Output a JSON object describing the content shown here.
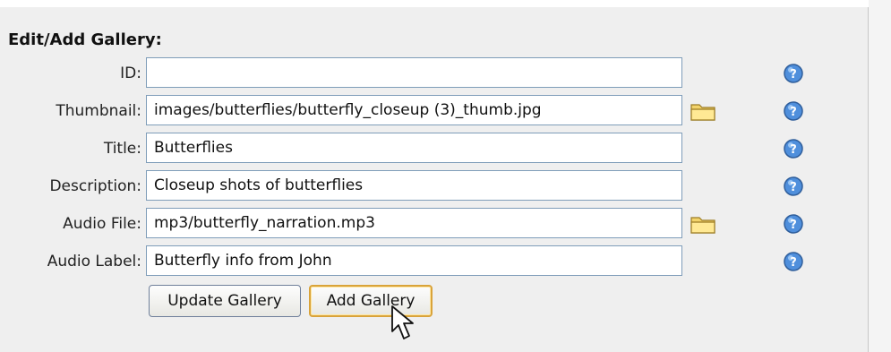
{
  "form": {
    "heading": "Edit/Add Gallery:",
    "fields": [
      {
        "label": "ID:",
        "value": "",
        "has_browse": false
      },
      {
        "label": "Thumbnail:",
        "value": "images/butterflies/butterfly_closeup (3)_thumb.jpg",
        "has_browse": true
      },
      {
        "label": "Title:",
        "value": "Butterflies",
        "has_browse": false
      },
      {
        "label": "Description:",
        "value": "Closeup shots of butterflies",
        "has_browse": false
      },
      {
        "label": "Audio File:",
        "value": "mp3/butterfly_narration.mp3",
        "has_browse": true
      },
      {
        "label": "Audio Label:",
        "value": "Butterfly info from John",
        "has_browse": false
      }
    ],
    "buttons": {
      "update": "Update Gallery",
      "add": "Add Gallery"
    }
  },
  "icons": {
    "browse": "folder-icon",
    "help": "help-icon",
    "cursor": "mouse-pointer-icon"
  },
  "colors": {
    "panel_bg": "#efefef",
    "input_border": "#7f9db9",
    "help_blue": "#4f8fdc",
    "folder_yellow": "#f2d36b",
    "active_button_border": "#d9a33a"
  }
}
